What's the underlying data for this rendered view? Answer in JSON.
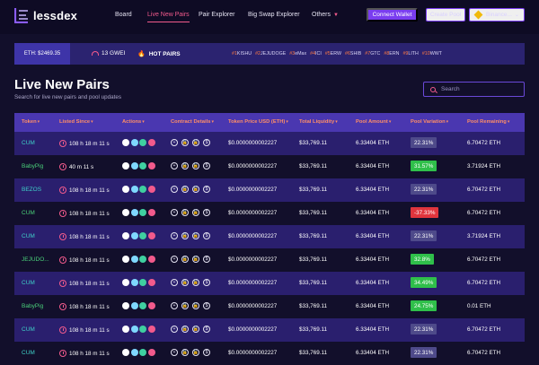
{
  "nav": {
    "logo_text": "lessdex",
    "links": [
      {
        "label": "Board",
        "active": false
      },
      {
        "label": "Live New Pairs",
        "active": true
      },
      {
        "label": "Pair Explorer",
        "active": false
      },
      {
        "label": "Big Swap Explorer",
        "active": false
      },
      {
        "label": "Others",
        "active": false
      }
    ],
    "connect_label": "Connect Wallet",
    "pool_label": "Create Pool",
    "chain_label": "Binance..."
  },
  "ticker": {
    "eth_price": "ETH: $2469.35",
    "gas": "13 GWEI",
    "hot_label": "HOT PAIRS",
    "hot_pairs": [
      {
        "rank": "#1",
        "name": "KISHU"
      },
      {
        "rank": "#2",
        "name": "JEJUDOGE"
      },
      {
        "rank": "#3",
        "name": "eMax"
      },
      {
        "rank": "#4",
        "name": "ICI"
      },
      {
        "rank": "#5",
        "name": "ERW"
      },
      {
        "rank": "#6",
        "name": "SHIB"
      },
      {
        "rank": "#7",
        "name": "GTC"
      },
      {
        "rank": "#8",
        "name": "ERN"
      },
      {
        "rank": "#9",
        "name": "LITH"
      },
      {
        "rank": "#10",
        "name": "WWT"
      }
    ]
  },
  "page": {
    "title": "Live New Pairs",
    "subtitle": "Search for live new pairs and pool updates",
    "search_placeholder": "Search"
  },
  "table": {
    "headers": [
      "Token",
      "Listed Since",
      "Actions",
      "Contract Details",
      "Token Price USD (ETH)",
      "Total Liquidity",
      "Pool Amount",
      "Pool Variation",
      "Pool Remaining"
    ],
    "rows": [
      {
        "token": "CUM",
        "token_color": "cyan",
        "since": "108 h 18 m 11 s",
        "price": "$0.0000000002227",
        "liquidity": "$33,769.11",
        "amount": "6.33404 ETH",
        "variation": "22.31%",
        "variation_kind": "neutral",
        "remaining": "6.70472 ETH"
      },
      {
        "token": "BabyPig",
        "token_color": "green",
        "since": "40 m 11 s",
        "price": "$0.0000000002227",
        "liquidity": "$33,769.11",
        "amount": "6.33404 ETH",
        "variation": "31.57%",
        "variation_kind": "up",
        "remaining": "3.71924 ETH"
      },
      {
        "token": "BEZOS",
        "token_color": "cyan",
        "since": "108 h 18 m 11 s",
        "price": "$0.0000000002227",
        "liquidity": "$33,769.11",
        "amount": "6.33404 ETH",
        "variation": "22.31%",
        "variation_kind": "neutral",
        "remaining": "6.70472 ETH"
      },
      {
        "token": "CUM",
        "token_color": "green",
        "since": "108 h 18 m 11 s",
        "price": "$0.0000000002227",
        "liquidity": "$33,769.11",
        "amount": "6.33404 ETH",
        "variation": "-37.33%",
        "variation_kind": "down",
        "remaining": "6.70472 ETH"
      },
      {
        "token": "CUM",
        "token_color": "cyan",
        "since": "108 h 18 m 11 s",
        "price": "$0.0000000002227",
        "liquidity": "$33,769.11",
        "amount": "6.33404 ETH",
        "variation": "22.31%",
        "variation_kind": "neutral",
        "remaining": "3.71924 ETH"
      },
      {
        "token": "JEJUDO...",
        "token_color": "green",
        "since": "108 h 18 m 11 s",
        "price": "$0.0000000002227",
        "liquidity": "$33,769.11",
        "amount": "6.33404 ETH",
        "variation": "32.8%",
        "variation_kind": "up",
        "remaining": "6.70472 ETH"
      },
      {
        "token": "CUM",
        "token_color": "cyan",
        "since": "108 h 18 m 11 s",
        "price": "$0.0000000002227",
        "liquidity": "$33,769.11",
        "amount": "6.33404 ETH",
        "variation": "34.49%",
        "variation_kind": "up",
        "remaining": "6.70472 ETH"
      },
      {
        "token": "BabyPig",
        "token_color": "green",
        "since": "108 h 18 m 11 s",
        "price": "$0.0000000002227",
        "liquidity": "$33,769.11",
        "amount": "6.33404 ETH",
        "variation": "24.75%",
        "variation_kind": "up",
        "remaining": "0.01 ETH"
      },
      {
        "token": "CUM",
        "token_color": "cyan",
        "since": "108 h 18 m 11 s",
        "price": "$0.0000000002227",
        "liquidity": "$33,769.11",
        "amount": "6.33404 ETH",
        "variation": "22.31%",
        "variation_kind": "neutral",
        "remaining": "6.70472 ETH"
      },
      {
        "token": "CUM",
        "token_color": "cyan",
        "since": "108 h 18 m 11 s",
        "price": "$0.0000000002227",
        "liquidity": "$33,769.11",
        "amount": "6.33404 ETH",
        "variation": "22.31%",
        "variation_kind": "neutral",
        "remaining": "6.70472 ETH"
      }
    ]
  },
  "colors": {
    "background": "#120f2b",
    "accent_purple": "#7a3df0",
    "accent_pink": "#f25a8c",
    "header_row": "#4a37b0",
    "header_text": "#ff8e66",
    "row_alt": "#2a1f6e",
    "up": "#2fbf4a",
    "down": "#e0353d",
    "neutral": "#4e4a8a"
  }
}
